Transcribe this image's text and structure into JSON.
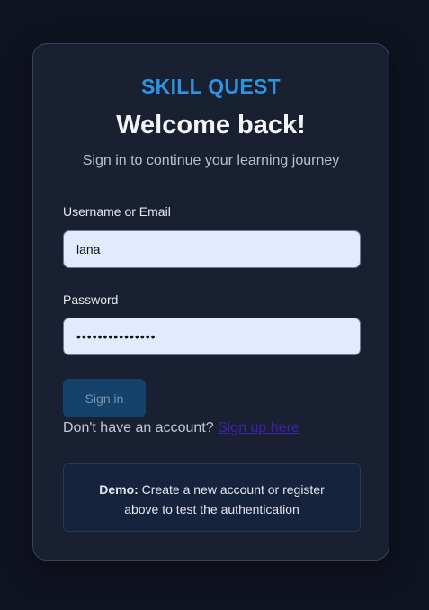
{
  "brand": "SKILL QUEST",
  "heading": "Welcome back!",
  "subheading": "Sign in to continue your learning journey",
  "form": {
    "username_label": "Username or Email",
    "username_value": "lana",
    "password_label": "Password",
    "password_value": "•••••••••••••••",
    "submit_label": "Sign in"
  },
  "signup": {
    "prompt": "Don't have an account?",
    "link": "Sign up here"
  },
  "demo": {
    "label": "Demo:",
    "text": "Create a new account or register above to test the authentication"
  },
  "colors": {
    "page_bg": "#0f1320",
    "card_bg": "#182032",
    "brand": "#2f94df",
    "button_bg": "#15426b",
    "link": "#3e22a8"
  }
}
